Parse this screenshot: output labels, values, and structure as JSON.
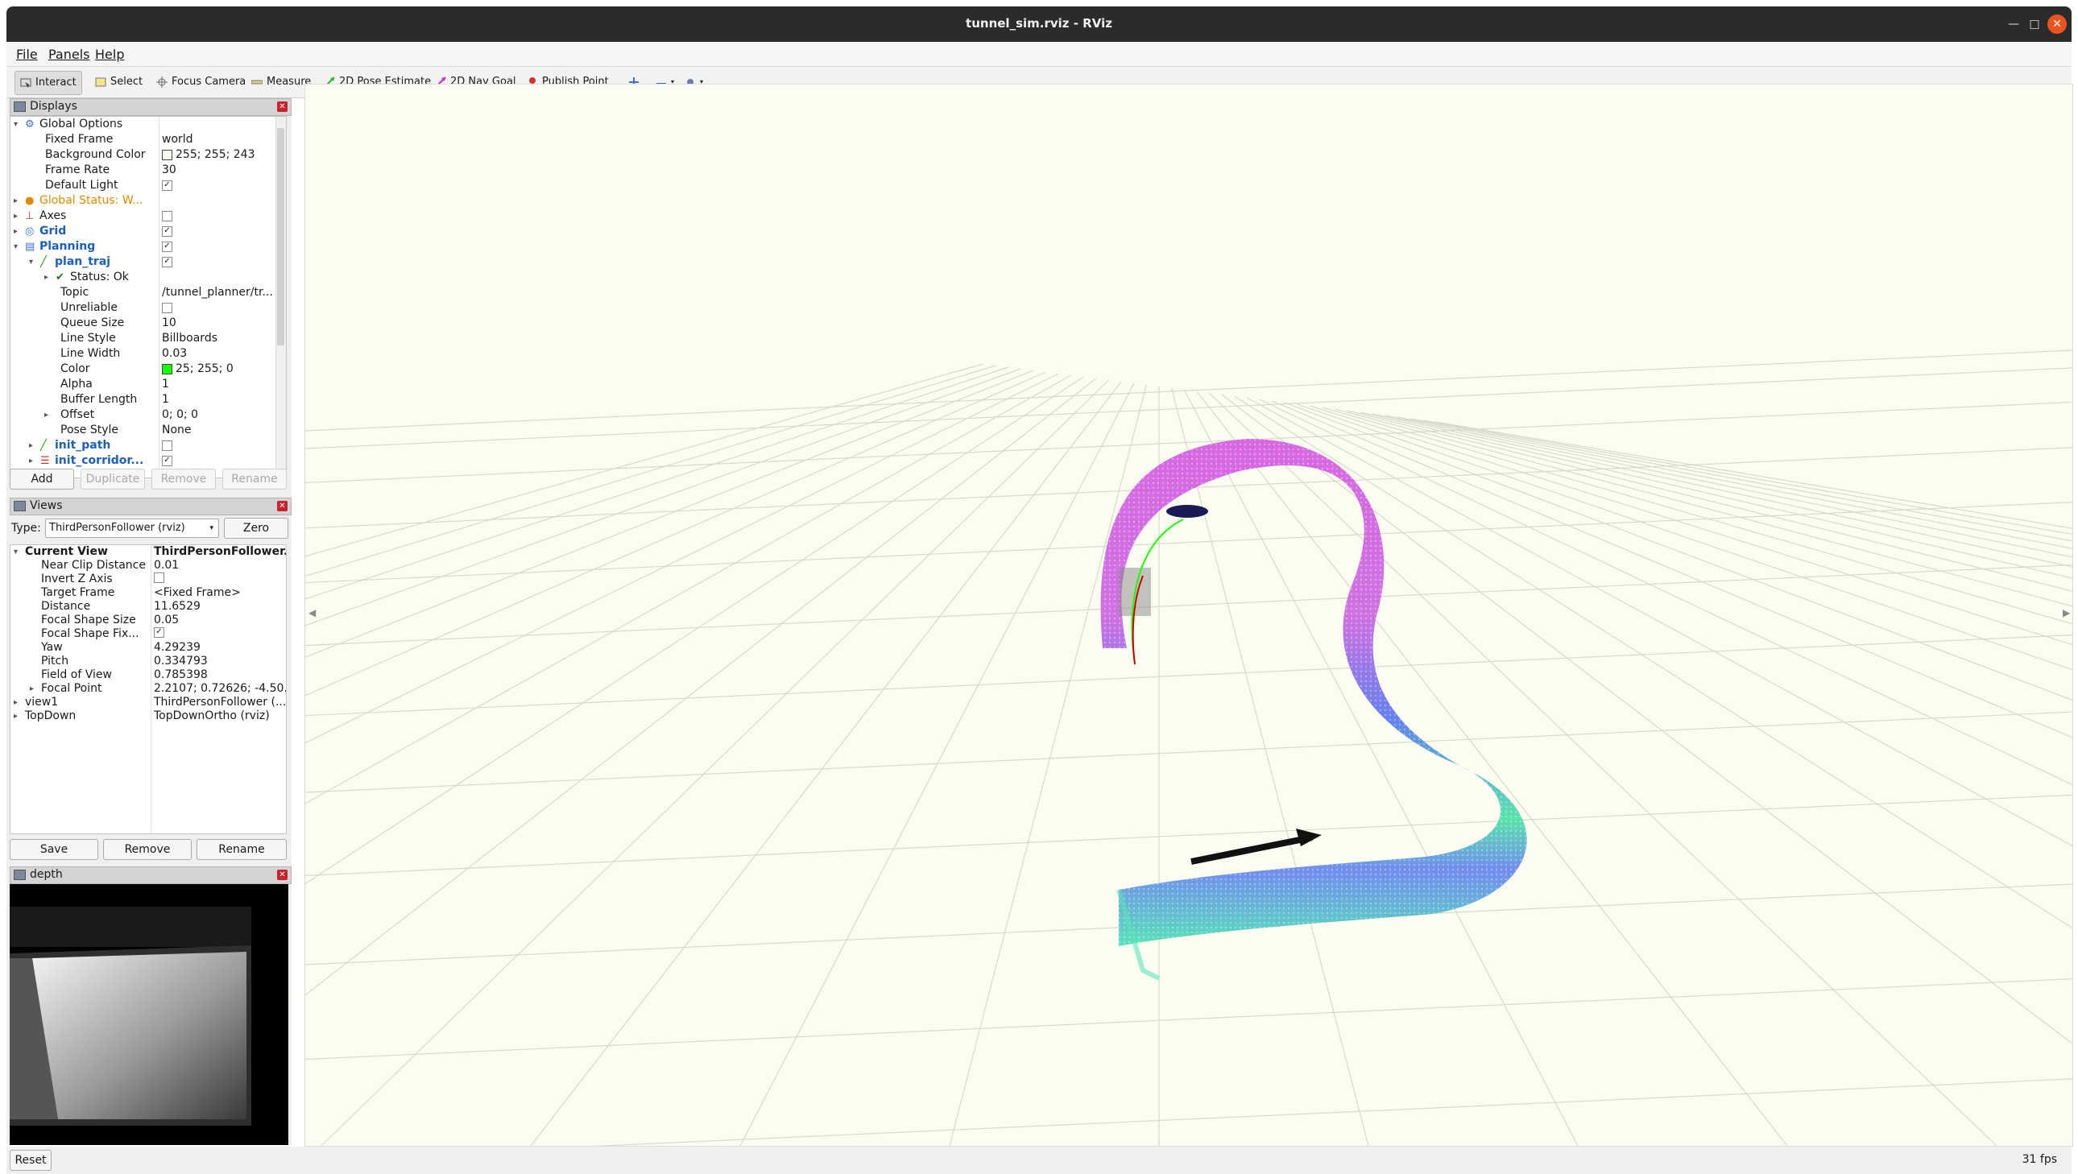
{
  "window": {
    "title": "tunnel_sim.rviz - RViz"
  },
  "menu": [
    "File",
    "Panels",
    "Help"
  ],
  "toolbar": {
    "tools": [
      {
        "label": "Interact",
        "icon": "interact-icon",
        "active": true
      },
      {
        "label": "Select",
        "icon": "select-icon"
      },
      {
        "label": "Focus Camera",
        "icon": "focus-camera-icon"
      },
      {
        "label": "Measure",
        "icon": "measure-icon"
      },
      {
        "label": "2D Pose Estimate",
        "icon": "pose-estimate-icon"
      },
      {
        "label": "2D Nav Goal",
        "icon": "nav-goal-icon"
      },
      {
        "label": "Publish Point",
        "icon": "publish-point-icon"
      }
    ],
    "icon_buttons": [
      "add-tool-icon",
      "remove-tool-icon",
      "camera-type-icon"
    ]
  },
  "displays": {
    "title": "Displays",
    "rows": [
      {
        "label": "Global Options",
        "value": ""
      },
      {
        "label": "Fixed Frame",
        "value": "world"
      },
      {
        "label": "Background Color",
        "value": "255; 255; 243"
      },
      {
        "label": "Frame Rate",
        "value": "30"
      },
      {
        "label": "Default Light",
        "value": "✓"
      },
      {
        "label": "Global Status: W...",
        "value": ""
      },
      {
        "label": "Axes",
        "value": ""
      },
      {
        "label": "Grid",
        "value": "✓"
      },
      {
        "label": "Planning",
        "value": "✓"
      },
      {
        "label": "plan_traj",
        "value": "✓"
      },
      {
        "label": "Status: Ok",
        "value": ""
      },
      {
        "label": "Topic",
        "value": "/tunnel_planner/tr..."
      },
      {
        "label": "Unreliable",
        "value": ""
      },
      {
        "label": "Queue Size",
        "value": "10"
      },
      {
        "label": "Line Style",
        "value": "Billboards"
      },
      {
        "label": "Line Width",
        "value": "0.03"
      },
      {
        "label": "Color",
        "value": "25; 255; 0"
      },
      {
        "label": "Alpha",
        "value": "1"
      },
      {
        "label": "Buffer Length",
        "value": "1"
      },
      {
        "label": "Offset",
        "value": "0; 0; 0"
      },
      {
        "label": "Pose Style",
        "value": "None"
      },
      {
        "label": "init_path",
        "value": ""
      },
      {
        "label": "init_corridor...",
        "value": "✓"
      }
    ],
    "buttons": {
      "add": "Add",
      "duplicate": "Duplicate",
      "remove": "Remove",
      "rename": "Rename"
    }
  },
  "views": {
    "title": "Views",
    "type_label": "Type:",
    "type_value": "ThirdPersonFollower (rviz)",
    "zero": "Zero",
    "rows": [
      {
        "label": "Current View",
        "value": "ThirdPersonFollower..."
      },
      {
        "label": "Near Clip Distance",
        "value": "0.01"
      },
      {
        "label": "Invert Z Axis",
        "value": ""
      },
      {
        "label": "Target Frame",
        "value": "<Fixed Frame>"
      },
      {
        "label": "Distance",
        "value": "11.6529"
      },
      {
        "label": "Focal Shape Size",
        "value": "0.05"
      },
      {
        "label": "Focal Shape Fix...",
        "value": "✓"
      },
      {
        "label": "Yaw",
        "value": "4.29239"
      },
      {
        "label": "Pitch",
        "value": "0.334793"
      },
      {
        "label": "Field of View",
        "value": "0.785398"
      },
      {
        "label": "Focal Point",
        "value": "2.2107; 0.72626; -4.50..."
      },
      {
        "label": "view1",
        "value": "ThirdPersonFollower (..."
      },
      {
        "label": "TopDown",
        "value": "TopDownOrtho (rviz)"
      }
    ],
    "buttons": {
      "save": "Save",
      "remove": "Remove",
      "rename": "Rename"
    }
  },
  "depth": {
    "title": "depth"
  },
  "status": {
    "reset": "Reset",
    "fps": "31 fps"
  },
  "colors": {
    "background": "#fcfcf1",
    "tunnel_top": "#d24fe0",
    "tunnel_mid": "#4a6cf0",
    "tunnel_low": "#3ee0a0",
    "trajectory": "#19ff00",
    "status_warning": "#e08a00",
    "link_blue": "#1d5fbf"
  }
}
